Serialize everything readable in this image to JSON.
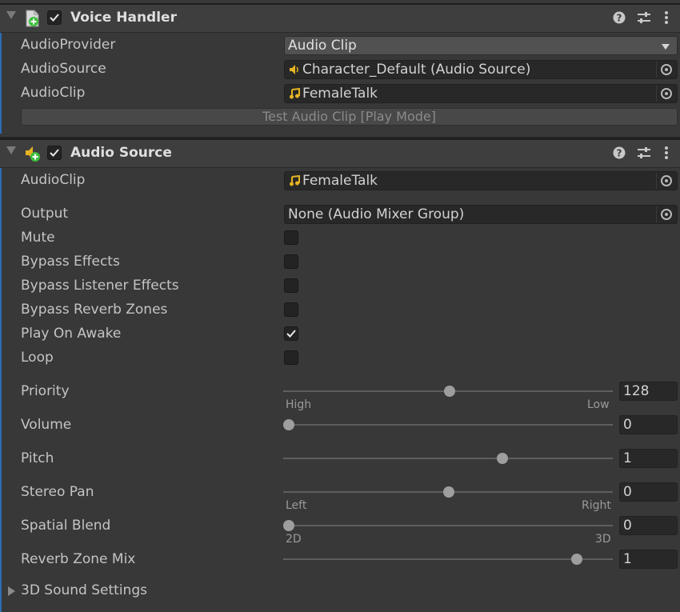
{
  "colors": {
    "background": "#383838",
    "header": "#3e3e3e",
    "field": "#282828",
    "accent": "#2d6db3",
    "clip_icon": "#e6b422",
    "add_badge": "#3fbf3f"
  },
  "voice_handler": {
    "title": "Voice Handler",
    "enabled": true,
    "icons": [
      "script-add-icon",
      "help-icon",
      "presets-icon",
      "kebab-menu-icon"
    ],
    "rows": [
      {
        "label": "AudioProvider",
        "value": "Audio Clip",
        "kind": "dropdown"
      },
      {
        "label": "AudioSource",
        "value": "Character_Default (Audio Source)",
        "kind": "object-field",
        "icon": "speaker-icon"
      },
      {
        "label": "AudioClip",
        "value": "FemaleTalk",
        "kind": "object-field",
        "icon": "music-note-icon"
      }
    ],
    "test_button": "Test Audio Clip [Play Mode]"
  },
  "audio_source": {
    "title": "Audio Source",
    "enabled": true,
    "audioclip": {
      "label": "AudioClip",
      "value": "FemaleTalk"
    },
    "output": {
      "label": "Output",
      "value": "None (Audio Mixer Group)"
    },
    "toggles": [
      {
        "label": "Mute",
        "checked": false
      },
      {
        "label": "Bypass Effects",
        "checked": false
      },
      {
        "label": "Bypass Listener Effects",
        "checked": false
      },
      {
        "label": "Bypass Reverb Zones",
        "checked": false
      },
      {
        "label": "Play On Awake",
        "checked": true
      },
      {
        "label": "Loop",
        "checked": false
      }
    ],
    "sliders": [
      {
        "label": "Priority",
        "value": "128",
        "min_label": "High",
        "max_label": "Low",
        "fraction": 0.502
      },
      {
        "label": "Volume",
        "value": "0",
        "fraction": 0.0
      },
      {
        "label": "Pitch",
        "value": "1",
        "fraction": 0.667
      },
      {
        "label": "Stereo Pan",
        "value": "0",
        "min_label": "Left",
        "max_label": "Right",
        "fraction": 0.5
      },
      {
        "label": "Spatial Blend",
        "value": "0",
        "min_label": "2D",
        "max_label": "3D",
        "fraction": 0.0
      },
      {
        "label": "Reverb Zone Mix",
        "value": "1",
        "fraction": 0.9
      }
    ],
    "foldout": "3D Sound Settings"
  }
}
